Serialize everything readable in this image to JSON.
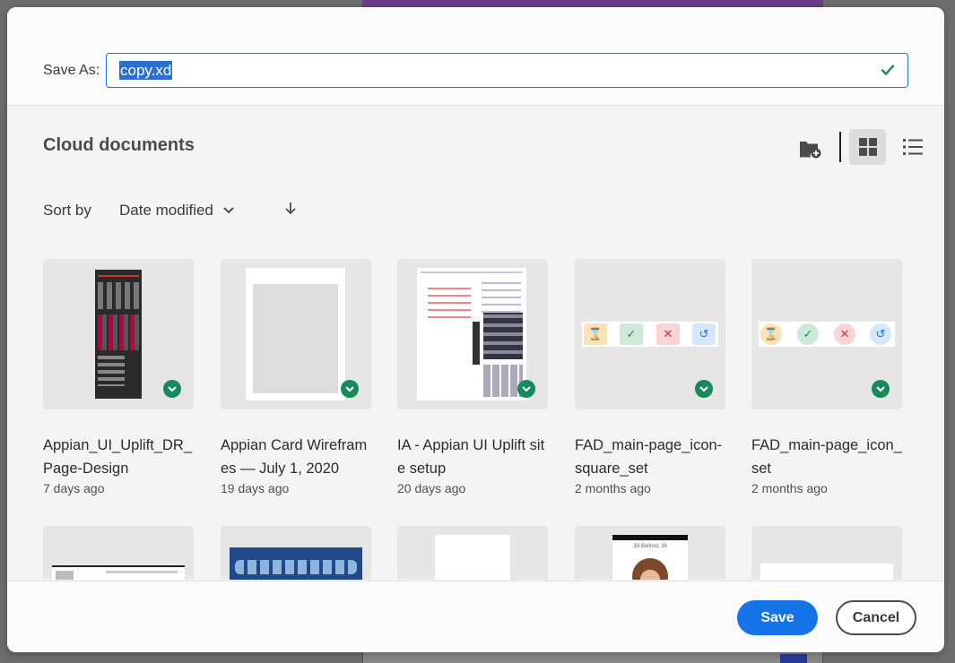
{
  "dialog": {
    "save_as_label": "Save As:",
    "filename": "copy.xd"
  },
  "browser": {
    "section_title": "Cloud documents",
    "sort_label": "Sort by",
    "sort_value": "Date modified"
  },
  "files": [
    {
      "name": "Appian_UI_Uplift_DR_Page-Design",
      "modified": "7 days ago"
    },
    {
      "name": "Appian Card Wireframes — July 1, 2020",
      "modified": "19 days ago"
    },
    {
      "name": "IA - Appian UI Uplift site setup",
      "modified": "20 days ago"
    },
    {
      "name": "FAD_main-page_icon-square_set",
      "modified": "2 months ago"
    },
    {
      "name": "FAD_main-page_icon_set",
      "modified": "2 months ago"
    }
  ],
  "partial_thumb_text": "Jill Belford, 36",
  "footer": {
    "save_label": "Save",
    "cancel_label": "Cancel"
  },
  "colors": {
    "accent": "#1473e6",
    "sync_green": "#168a5a"
  }
}
